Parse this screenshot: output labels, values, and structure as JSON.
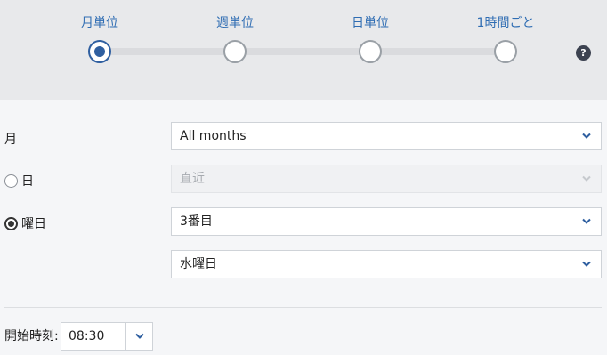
{
  "frequency": {
    "steps": [
      {
        "label": "月単位",
        "selected": true
      },
      {
        "label": "週単位",
        "selected": false
      },
      {
        "label": "日単位",
        "selected": false
      },
      {
        "label": "1時間ごと",
        "selected": false
      }
    ],
    "help_icon": "?"
  },
  "form": {
    "month": {
      "label": "月",
      "value": "All months"
    },
    "day": {
      "label": "日",
      "value": "直近",
      "checked": false,
      "disabled": true
    },
    "weekday": {
      "label": "曜日",
      "checked": true,
      "ordinal_value": "3番目",
      "day_value": "水曜日"
    }
  },
  "start_time": {
    "label": "開始時刻:",
    "value": "08:30"
  },
  "colors": {
    "accent": "#2f5fa0",
    "link": "#2f6db3"
  },
  "icons": {
    "dropdown": "chevron-down-icon",
    "help": "question-circle-icon"
  }
}
